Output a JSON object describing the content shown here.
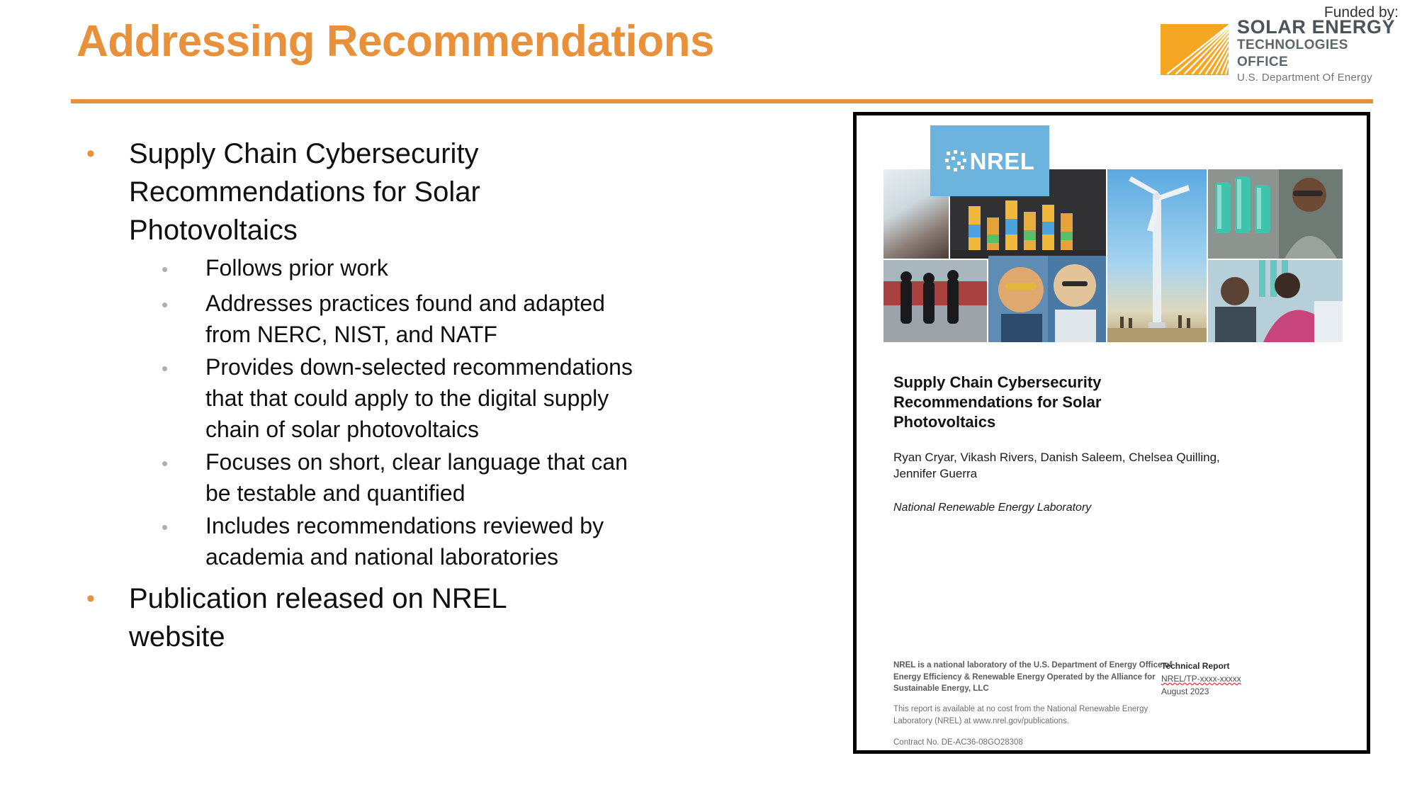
{
  "slide": {
    "title": "Addressing Recommendations",
    "accent_color": "#E8913A",
    "background": "#FFFFFF"
  },
  "funder": {
    "label": "Funded by:",
    "logo_name": "solar-energy-technologies-office-logo",
    "line1": "SOLAR ENERGY",
    "line2": "TECHNOLOGIES OFFICE",
    "line3": "U.S. Department Of Energy",
    "sunburst_color": "#F5A623"
  },
  "bullets": [
    {
      "level": 1,
      "marker": "•",
      "text": "Supply Chain Cybersecurity Recommendations for Solar Photovoltaics",
      "children": [
        {
          "level": 2,
          "marker": "•",
          "text": "Follows prior work"
        },
        {
          "level": 2,
          "marker": "•",
          "text": "Addresses practices found and adapted from NERC, NIST, and NATF"
        },
        {
          "level": 2,
          "marker": "•",
          "text": "Provides down-selected recommendations that that could apply to the digital supply chain of solar photovoltaics"
        },
        {
          "level": 2,
          "marker": "•",
          "text": "Focuses on short, clear language that can be testable and quantified"
        },
        {
          "level": 2,
          "marker": "•",
          "text": "Includes recommendations reviewed by academia and national laboratories"
        }
      ]
    },
    {
      "level": 1,
      "marker": "•",
      "text": "Publication released on NREL website",
      "children": []
    }
  ],
  "document_cover": {
    "logo_text": "NREL",
    "logo_color": "#6CB3DD",
    "title": "Supply Chain Cybersecurity Recommendations for Solar Photovoltaics",
    "authors": "Ryan Cryar, Vikash Rivers, Danish Saleem, Chelsea Quilling, Jennifer Guerra",
    "affiliation": "National Renewable Energy Laboratory",
    "footer_left_block1": "NREL is a national laboratory of the U.S. Department of Energy Office of Energy Efficiency & Renewable Energy Operated by the Alliance for Sustainable Energy, LLC",
    "footer_left_block2": "This report is available at no cost from the National Renewable Energy Laboratory (NREL) at www.nrel.gov/publications.",
    "footer_left_block3": "Contract No. DE-AC36-08GO28308",
    "footer_right_type": "Technical Report",
    "footer_right_number": "NREL/TP-xxxx-xxxxx",
    "footer_right_date": "August 2023"
  }
}
